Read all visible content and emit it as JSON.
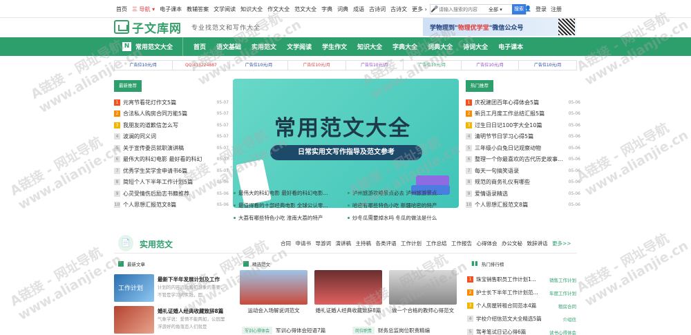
{
  "topnav": {
    "links": [
      "首页",
      "三 导航 ▾",
      "电子课本",
      "教辅答案",
      "文学阅读",
      "知识大全",
      "作文大全",
      "范文大全",
      "字典",
      "词典",
      "成语",
      "古诗词",
      "古诗文",
      "更多 ›"
    ],
    "search_placeholder": "请输入搜索的内容",
    "search_scope": "全部 ▾",
    "search_button": "搜索",
    "login": "登录",
    "register": "注册"
  },
  "header": {
    "logo_text": "子文库网",
    "slogan": "专业找范文和写作大全",
    "banner_text_pre": "学物理到\"",
    "banner_text_hi": "物理优学堂",
    "banner_text_post": "\"微信公众号"
  },
  "mainnav": {
    "first": "常用范文大全",
    "items": [
      "首页",
      "语文基础",
      "实用范文",
      "文学阅读",
      "学生作文",
      "知识大全",
      "字典大全",
      "词典大全",
      "诗词大全",
      "电子课本"
    ]
  },
  "ads": [
    {
      "text": "广告位10元/月",
      "color": "#1a3ea8"
    },
    {
      "text": "QQ:413224887",
      "color": "#e03c3c"
    },
    {
      "text": "广告位10元/月",
      "color": "#1a3ea8"
    },
    {
      "text": "广告位10元/月",
      "color": "#e03c3c"
    },
    {
      "text": "广告位10元/月",
      "color": "#8a3fd1"
    },
    {
      "text": "广告位10元/月",
      "color": "#2d9f6c"
    },
    {
      "text": "广告位10元/月",
      "color": "#8a3fd1"
    },
    {
      "text": "广告位10元/月",
      "color": "#1a3ea8"
    }
  ],
  "left_recommend": {
    "tag": "最新推荐",
    "items": [
      {
        "n": "1",
        "t": "元宵节看花灯作文5篇",
        "d": "05-07"
      },
      {
        "n": "2",
        "t": "合法私人购房合同万能5篇",
        "d": "05-07"
      },
      {
        "n": "3",
        "t": "我朋友的道歉信怎么写",
        "d": "05-07"
      },
      {
        "n": "4",
        "t": "波澜的同义词",
        "d": "05-07"
      },
      {
        "n": "5",
        "t": "关于宣传委员就职演讲稿",
        "d": "05-07"
      },
      {
        "n": "6",
        "t": "最伟大的科幻电影 最好看的科幻",
        "d": "05-07"
      },
      {
        "n": "7",
        "t": "优秀学生奖学金申请书6篇",
        "d": "05-07"
      },
      {
        "n": "8",
        "t": "简短个人下半年工作计划5篇",
        "d": "05-06"
      },
      {
        "n": "9",
        "t": "心灵受情伤后励志书籍推荐",
        "d": "05-06"
      },
      {
        "n": "10",
        "t": "个人思想汇报范文8篇",
        "d": "05-06"
      }
    ]
  },
  "hero": {
    "title": "常用范文大全",
    "subtitle": "日常实用文写作指导及范文参考"
  },
  "center_list": [
    [
      "最伟大的科幻电影 最好看的科幻电影...",
      "泸州旅游攻略景点必去 泸州旅游景点..."
    ],
    [
      "最值得看的十部经典电影 全球公认零...",
      "哈密有哪些特色小吃 新疆哈密的特产"
    ],
    [
      "大荔有哪些特色小吃 淮南大荔的特产",
      "炒冬瓜需要焯水吗 冬瓜的做法是什么"
    ]
  ],
  "right_hot": {
    "tag": "热门推荐",
    "items": [
      {
        "n": "1",
        "t": "庆祝建团百年心得体会5篇",
        "d": "05-06"
      },
      {
        "n": "2",
        "t": "新员工月度工作总结汇报5篇",
        "d": "05-06"
      },
      {
        "n": "3",
        "t": "过生日日记100字大全10篇",
        "d": "05-06"
      },
      {
        "n": "4",
        "t": "清明节节日学习心得5篇",
        "d": "05-06"
      },
      {
        "n": "5",
        "t": "三年级小白兔日记观察动物",
        "d": "05-06"
      },
      {
        "n": "6",
        "t": "整理一个你最喜欢的古代历史故事...",
        "d": "05-06"
      },
      {
        "n": "7",
        "t": "每天一句搞笑语录",
        "d": "05-06"
      },
      {
        "n": "8",
        "t": "规范的商务礼仪有哪些",
        "d": "05-06"
      },
      {
        "n": "9",
        "t": "爱情语录精选",
        "d": "05-06"
      },
      {
        "n": "10",
        "t": "个人思想汇报范文8篇",
        "d": "05-06"
      }
    ]
  },
  "section": {
    "title": "实用范文",
    "tabs": [
      "合同",
      "申请书",
      "导游词",
      "演讲稿",
      "主持稿",
      "各类评语",
      "工作计划",
      "工作总结",
      "工作报告",
      "心得体会",
      "办公文秘",
      "致辞讲话"
    ],
    "more": "更多>>"
  },
  "latest": {
    "header": "最新文章",
    "articles": [
      {
        "title": "最新下半年发展计划及工作",
        "desc": "计划的内容远比我们想象的重要，不管是学习的实践，固",
        "thumb_label": "工作计划"
      },
      {
        "title": "婚礼证婚人经典收藏致辞8篇",
        "desc": "气象学说：爱情不能两如，公园里浮游好的角落恋人们就是"
      }
    ]
  },
  "featured": {
    "header": "精选范文",
    "captions": [
      "运动会入场解说词范文",
      "婚礼证婚人经典收藏致辞8篇",
      "做一个合格的教师心得范文"
    ],
    "bottom": [
      {
        "tag": "军训心得体会",
        "text": "军训心得体会短语7篇"
      },
      {
        "tag": "岗位职责",
        "text": "财务总监岗位职责精编"
      }
    ]
  },
  "ranking": {
    "header": "热门排行榜",
    "items": [
      {
        "n": "1",
        "t": "珠宝销售职员工作计划1...",
        "c": "销售工作计划"
      },
      {
        "n": "2",
        "t": "护士长下半年工作计划范...",
        "c": "年度工作计划"
      },
      {
        "n": "3",
        "t": "个人房屋转租合同范本4篇",
        "c": "租房合同"
      },
      {
        "n": "4",
        "t": "学校介绍信范文大全精选5篇",
        "c": "介绍信"
      },
      {
        "n": "5",
        "t": "驾考笔试日记心得6篇",
        "c": "读书心得体会"
      }
    ]
  },
  "watermark": "A链接 - 网址导航\nwww.alianjie.cn"
}
